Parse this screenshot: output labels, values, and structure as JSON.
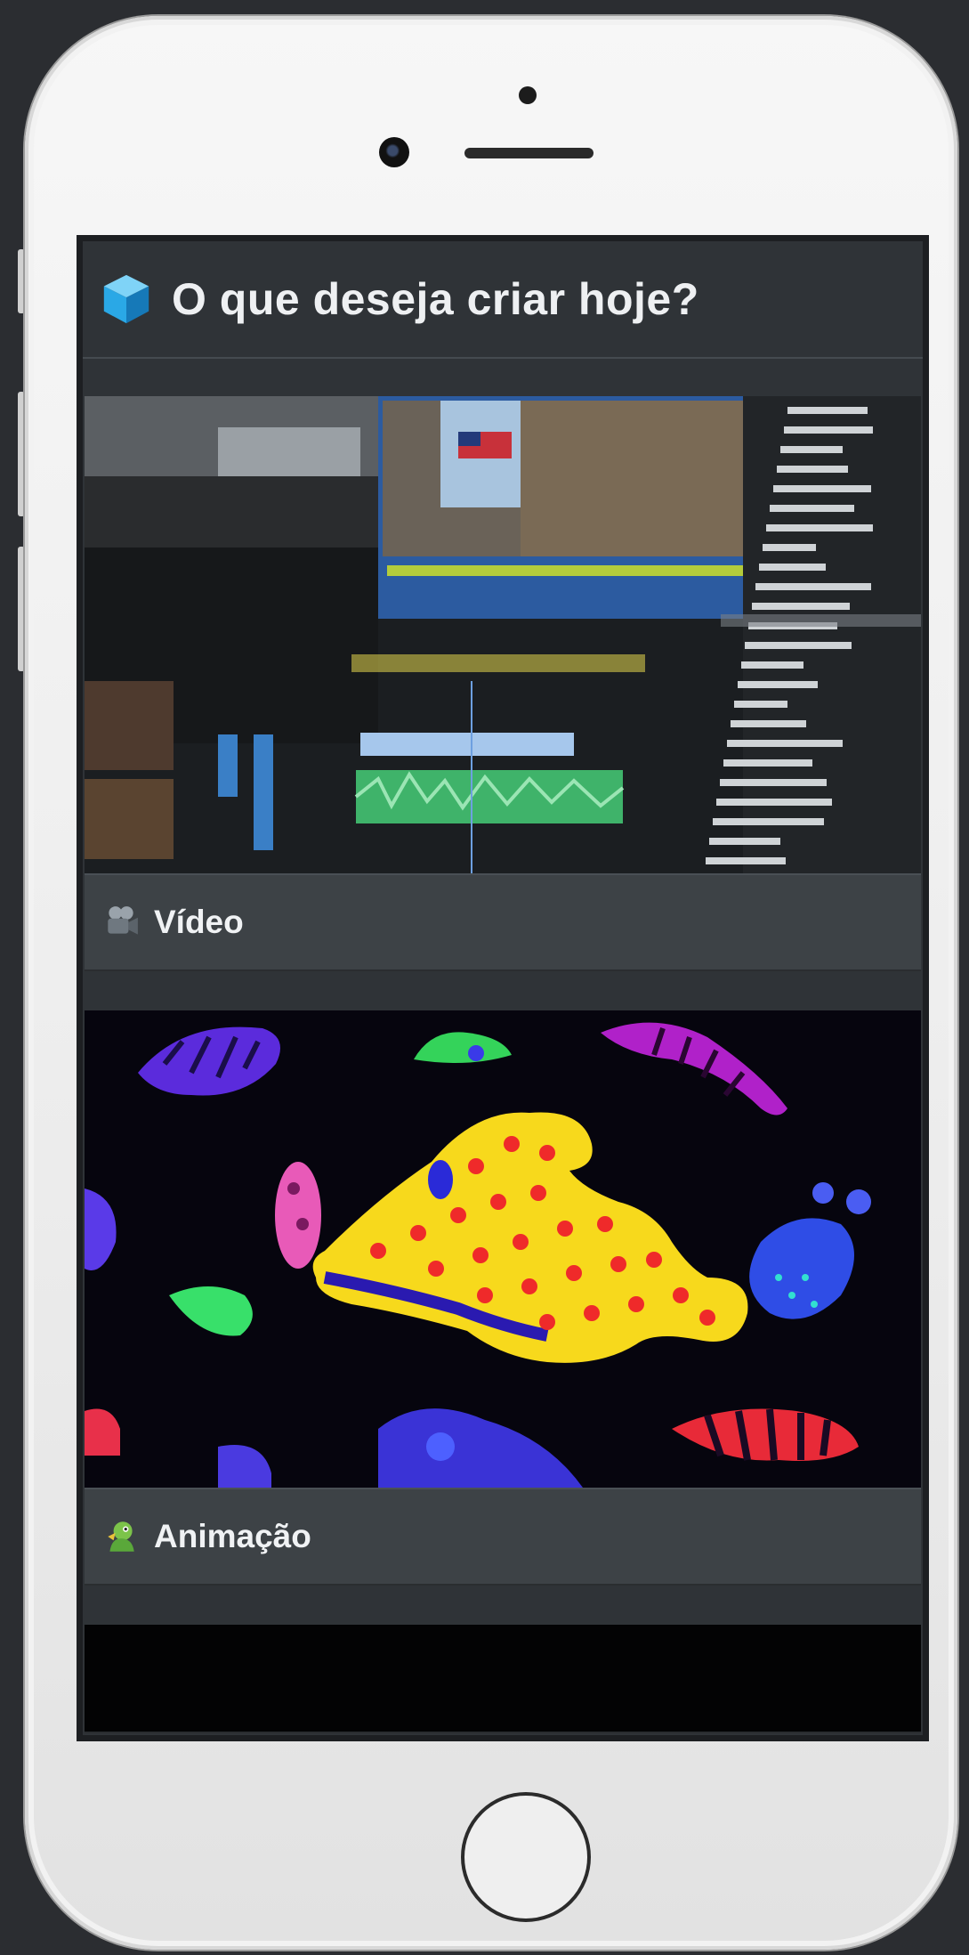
{
  "header": {
    "icon": "cube-icon",
    "title": "O que deseja criar hoje?"
  },
  "cards": [
    {
      "label": "Vídeo",
      "icon": "video-camera-icon",
      "image": "video-editing-software-screenshot"
    },
    {
      "label": "Animação",
      "icon": "dragon-icon",
      "image": "colorful-animated-creatures-artwork"
    }
  ],
  "colors": {
    "screen_background": "#2f3337",
    "card_background": "#3d4246",
    "text": "#f0f2f4",
    "cube_accent": "#2aa8e6"
  }
}
